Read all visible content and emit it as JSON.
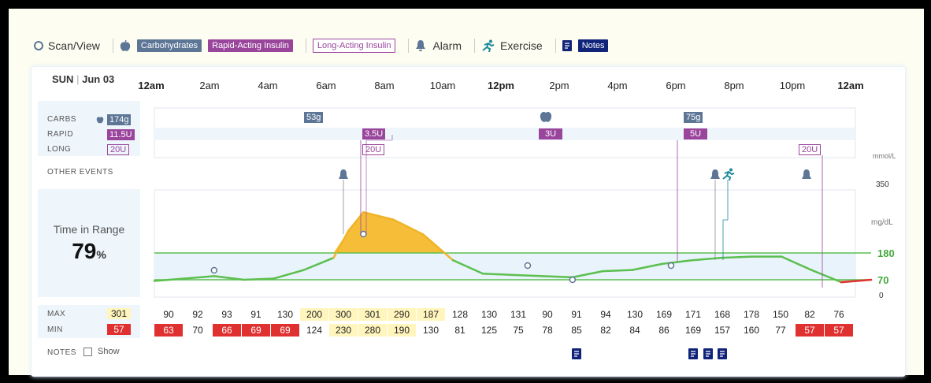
{
  "legend": {
    "scan": "Scan/View",
    "carbs": "Carbohydrates",
    "rapid": "Rapid-Acting Insulin",
    "long": "Long-Acting Insulin",
    "alarm": "Alarm",
    "exercise": "Exercise",
    "notes": "Notes"
  },
  "header": {
    "day": "SUN",
    "date": "Jun 03"
  },
  "times": [
    "12am",
    "2am",
    "4am",
    "6am",
    "8am",
    "10am",
    "12pm",
    "2pm",
    "4pm",
    "6pm",
    "8pm",
    "10pm",
    "12am"
  ],
  "rows": {
    "carbs": "CARBS",
    "carbs_total": "174g",
    "rapid": "RAPID",
    "rapid_total": "11.5U",
    "long": "LONG",
    "long_total": "20U",
    "other": "OTHER EVENTS"
  },
  "events": {
    "carb1": "53g",
    "carb2": "75g",
    "rapid1": "3.5U",
    "rapid2": "3U",
    "rapid3": "5U",
    "long1": "20U",
    "long2": "20U"
  },
  "tir": {
    "label": "Time in Range",
    "value": "79",
    "unit": "%"
  },
  "axis": {
    "mmol": "mmol/L",
    "mgdl": "mg/dL",
    "top": "350",
    "high": "180",
    "low": "70",
    "zero": "0"
  },
  "summary": {
    "max_label": "MAX",
    "max_total": "301",
    "min_label": "MIN",
    "min_total": "57",
    "notes_label": "NOTES",
    "show": "Show",
    "max": [
      "90",
      "92",
      "93",
      "91",
      "130",
      "200",
      "300",
      "301",
      "290",
      "187",
      "128",
      "130",
      "131",
      "90",
      "91",
      "94",
      "130",
      "169",
      "171",
      "168",
      "178",
      "150",
      "82",
      "76"
    ],
    "min": [
      "63",
      "70",
      "66",
      "69",
      "69",
      "124",
      "230",
      "280",
      "190",
      "130",
      "81",
      "125",
      "75",
      "78",
      "85",
      "82",
      "84",
      "86",
      "169",
      "157",
      "160",
      "77",
      "57",
      "57"
    ]
  },
  "colors": {
    "carb": "#5d7696",
    "rapid": "#99459c",
    "notes": "#10247a",
    "range": "#5cbf4e",
    "high": "#f0b429",
    "low": "#e03131"
  },
  "chart_data": {
    "type": "line",
    "x": [
      "12am",
      "1am",
      "2am",
      "3am",
      "4am",
      "5am",
      "6am",
      "6:30am",
      "7am",
      "7:30am",
      "8am",
      "9am",
      "10am",
      "11am",
      "12pm",
      "1pm",
      "2pm",
      "3pm",
      "4pm",
      "5pm",
      "6pm",
      "7pm",
      "8pm",
      "9pm",
      "10pm",
      "11pm",
      "11:59pm"
    ],
    "series": [
      {
        "values": [
          65,
          75,
          85,
          70,
          75,
          110,
          160,
          240,
          290,
          280,
          270,
          230,
          150,
          95,
          90,
          85,
          80,
          105,
          110,
          135,
          150,
          160,
          165,
          165,
          110,
          60,
          70
        ]
      }
    ],
    "ylim": [
      0,
      350
    ],
    "target_range": [
      70,
      180
    ]
  }
}
